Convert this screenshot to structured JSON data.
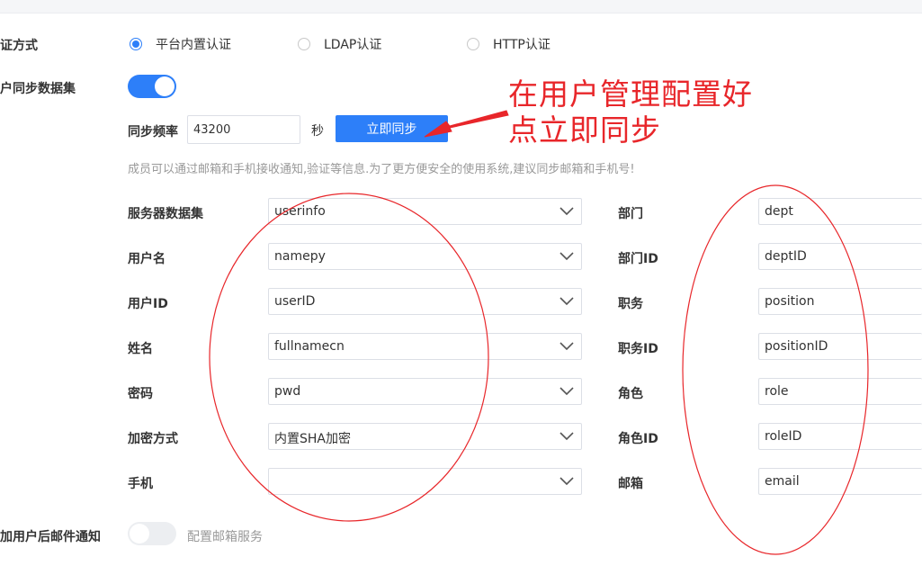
{
  "auth": {
    "label": "证方式",
    "options": [
      {
        "label": "平台内置认证",
        "selected": true
      },
      {
        "label": "LDAP认证",
        "selected": false
      },
      {
        "label": "HTTP认证",
        "selected": false
      }
    ]
  },
  "sync": {
    "label": "户同步数据集",
    "enabled": true,
    "freq_label": "同步频率",
    "freq_value": "43200",
    "freq_unit": "秒",
    "sync_now_label": "立即同步",
    "hint": "成员可以通过邮箱和手机接收通知,验证等信息.为了更方便安全的使用系统,建议同步邮箱和手机号!"
  },
  "left_fields": [
    {
      "label": "服务器数据集",
      "value": "userinfo"
    },
    {
      "label": "用户名",
      "value": "namepy"
    },
    {
      "label": "用户ID",
      "value": "userID"
    },
    {
      "label": "姓名",
      "value": "fullnamecn"
    },
    {
      "label": "密码",
      "value": "pwd"
    },
    {
      "label": "加密方式",
      "value": "内置SHA加密"
    },
    {
      "label": "手机",
      "value": ""
    }
  ],
  "right_fields": [
    {
      "label": "部门",
      "value": "dept"
    },
    {
      "label": "部门ID",
      "value": "deptID"
    },
    {
      "label": "职务",
      "value": "position"
    },
    {
      "label": "职务ID",
      "value": "positionID"
    },
    {
      "label": "角色",
      "value": "role"
    },
    {
      "label": "角色ID",
      "value": "roleID"
    },
    {
      "label": "邮箱",
      "value": "email"
    }
  ],
  "notify": {
    "label": "加用户后邮件通知",
    "enabled": false,
    "config_label": "配置邮箱服务"
  },
  "annotation": {
    "line1": "在用户管理配置好",
    "line2": "点立即同步"
  },
  "colors": {
    "primary": "#2d7ff9",
    "annotation": "#e8262a"
  },
  "icons": {
    "select_arrow": "chevron-down-icon"
  }
}
